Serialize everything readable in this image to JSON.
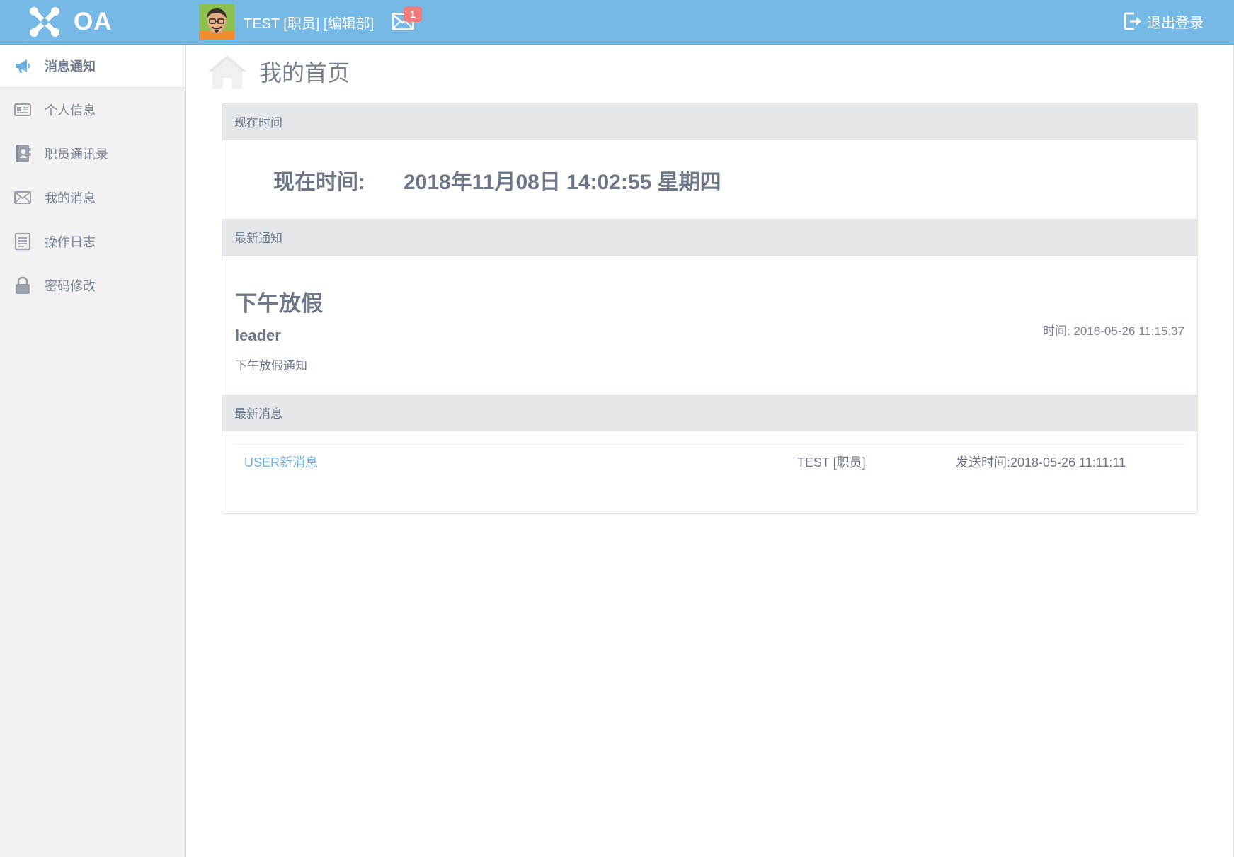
{
  "header": {
    "app_name": "OA",
    "user_label": "TEST [职员] [编辑部]",
    "mail_badge": "1",
    "logout_label": "退出登录",
    "bar_color": "#77b9e5"
  },
  "sidebar": {
    "items": [
      {
        "label": "消息通知",
        "icon": "megaphone-icon",
        "active": true
      },
      {
        "label": "个人信息",
        "icon": "id-card-icon",
        "active": false
      },
      {
        "label": "职员通讯录",
        "icon": "address-book-icon",
        "active": false
      },
      {
        "label": "我的消息",
        "icon": "envelope-icon",
        "active": false
      },
      {
        "label": "操作日志",
        "icon": "log-list-icon",
        "active": false
      },
      {
        "label": "密码修改",
        "icon": "lock-icon",
        "active": false
      }
    ]
  },
  "page": {
    "title": "我的首页"
  },
  "time_section": {
    "header": "现在时间",
    "label": "现在时间:",
    "value": "2018年11月08日 14:02:55 星期四"
  },
  "notice_section": {
    "header": "最新通知",
    "title": "下午放假",
    "author": "leader",
    "body": "下午放假通知",
    "time": "时间:   2018-05-26 11:15:37"
  },
  "message_section": {
    "header": "最新消息",
    "rows": [
      {
        "subject": "USER新消息",
        "sender": "TEST [职员]",
        "time": "发送时间:2018-05-26 11:11:11"
      }
    ]
  }
}
